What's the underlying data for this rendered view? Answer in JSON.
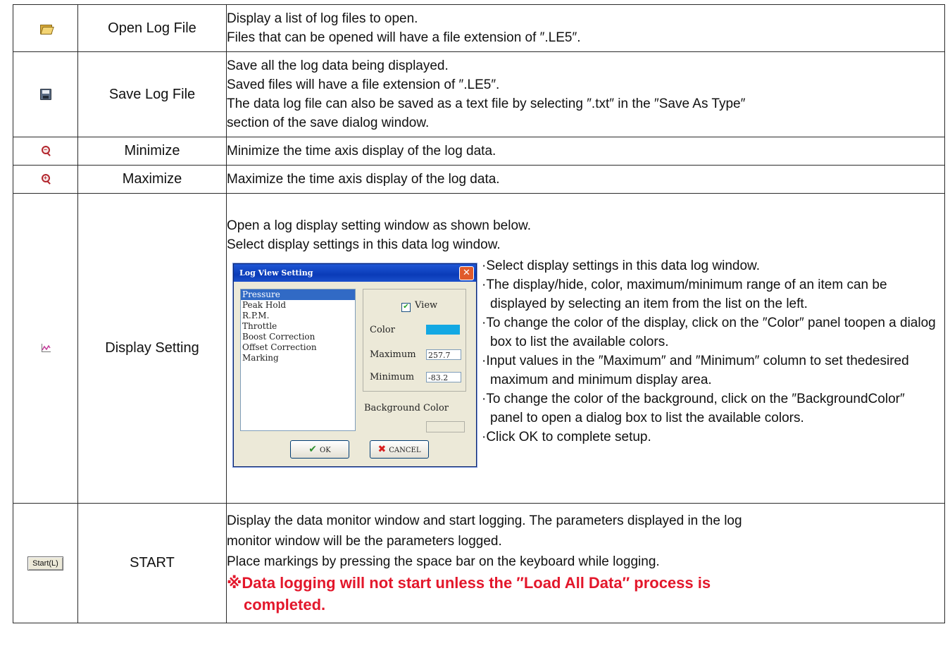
{
  "rows": [
    {
      "icon": "open-folder-icon",
      "name": "Open Log File",
      "lines": [
        "Display a list of log files to open.",
        "Files that can be opened will have a file extension of ″.LE5″."
      ]
    },
    {
      "icon": "save-disk-icon",
      "name": "Save Log File",
      "lines": [
        "Save all the log data being displayed.",
        "Saved files will have a file extension of ″.LE5″.",
        "The data log file can also be saved as a text file by selecting ″.txt″ in the ″Save As Type″",
        "section of the save dialog window."
      ]
    },
    {
      "icon": "zoom-out-icon",
      "name": "Minimize",
      "lines": [
        "Minimize the time axis display of the log data."
      ]
    },
    {
      "icon": "zoom-in-icon",
      "name": "Maximize",
      "lines": [
        "Maximize the time axis display of the log data."
      ]
    },
    {
      "icon": "chart-setting-icon",
      "name": "Display Setting",
      "intro": [
        "Open a log display setting window as shown below.",
        "Select display settings in this data log window."
      ],
      "dialog": {
        "title": "Log View Setting",
        "close": "✕",
        "items": [
          "Pressure",
          "Peak Hold",
          "R.P.M.",
          "Throttle",
          "Boost Correction",
          "Offset Correction",
          "Marking"
        ],
        "view_label": "View",
        "color_label": "Color",
        "color_value": "#13a8e3",
        "max_label": "Maximum",
        "max_value": "257.7",
        "min_label": "Minimum",
        "min_value": "-83.2",
        "bg_label": "Background Color",
        "ok_label": "OK",
        "cancel_label": "CANCEL"
      },
      "notes": [
        "·Select display settings in this data log window.",
        "·The display/hide, color, maximum/minimum range of an item can be displayed by selecting an item from the list on the left.",
        "·To change the color of the display, click on the ″Color″ panel toopen a dialog box to list the available colors.",
        "·Input values in the ″Maximum″ and ″Minimum″ column to set thedesired maximum and minimum display area.",
        "·To change the color of the background, click on the ″BackgroundColor″ panel to open a dialog box to list the available colors.",
        "·Click OK to complete setup."
      ]
    },
    {
      "icon_label": "Start(L)",
      "name": "START",
      "lines": [
        "Display the data monitor window and start logging. The parameters displayed in the log",
        "monitor window will be the parameters logged.",
        "Place markings by pressing the space bar on the keyboard while logging."
      ],
      "warning": [
        "※Data logging will not start unless the ″Load All Data″ process is",
        "completed."
      ]
    }
  ],
  "colors": {
    "warning": "#e3172b",
    "border": "#2a2a2a"
  }
}
